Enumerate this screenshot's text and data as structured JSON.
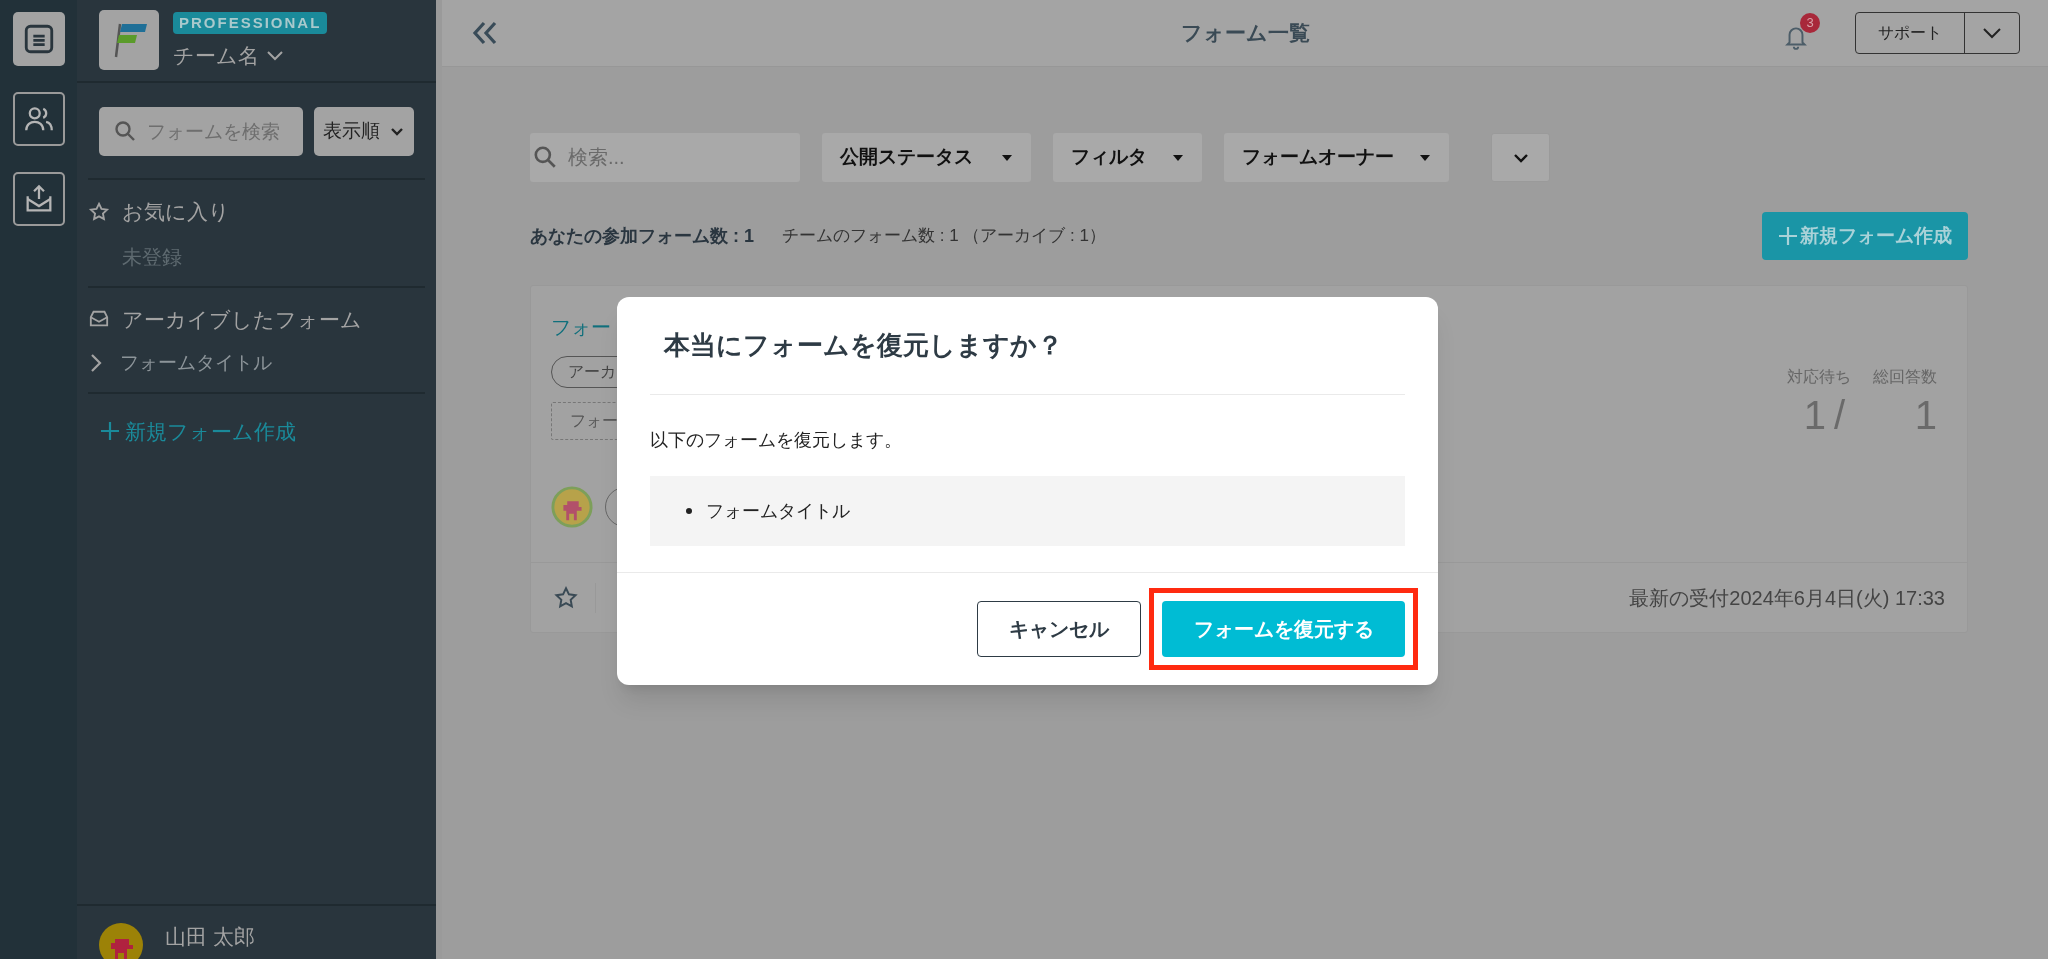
{
  "rail": {
    "items": [
      {
        "kind": "forms",
        "selected": true
      },
      {
        "kind": "members",
        "selected": false
      },
      {
        "kind": "export",
        "selected": false
      }
    ]
  },
  "sidebar": {
    "team": {
      "plan_badge": "PROFESSIONAL",
      "name": "チーム名"
    },
    "search": {
      "placeholder": "フォームを検索"
    },
    "sort_button": "表示順",
    "favorites": {
      "label": "お気に入り",
      "empty": "未登録"
    },
    "archived": {
      "label": "アーカイブしたフォーム",
      "items": [
        {
          "label": "フォームタイトル",
          "expanded": false
        }
      ]
    },
    "new_form": "新規フォーム作成",
    "user": {
      "name": "山田 太郎"
    }
  },
  "header": {
    "title": "フォーム一覧",
    "notification_count": "3",
    "support_button": "サポート"
  },
  "filters": {
    "search_placeholder": "検索...",
    "dropdowns": [
      "公開ステータス",
      "フィルタ",
      "フォームオーナー"
    ]
  },
  "counts": {
    "own": "あなたの参加フォーム数 : 1",
    "team": "チームのフォーム数 : 1 （アーカイブ : 1）"
  },
  "new_form_button": "新規フォーム作成",
  "card": {
    "title": "フォー",
    "tags": [
      {
        "label": "アーカ",
        "kind": "status"
      },
      {
        "label": "フォー",
        "kind": "dashed"
      }
    ],
    "stats": [
      {
        "label": "対応待ち",
        "value": "1"
      },
      {
        "label": "総回答数",
        "value": "1"
      }
    ],
    "stats_separator": "/",
    "latest": "最新の受付2024年6月4日(火) 17:33"
  },
  "modal": {
    "title": "本当にフォームを復元しますか？",
    "message": "以下のフォームを復元します。",
    "items": [
      "フォームタイトル"
    ],
    "buttons": [
      {
        "label": "キャンセル",
        "kind": "secondary",
        "highlighted": false
      },
      {
        "label": "フォームを復元する",
        "kind": "primary",
        "highlighted": true
      }
    ]
  }
}
